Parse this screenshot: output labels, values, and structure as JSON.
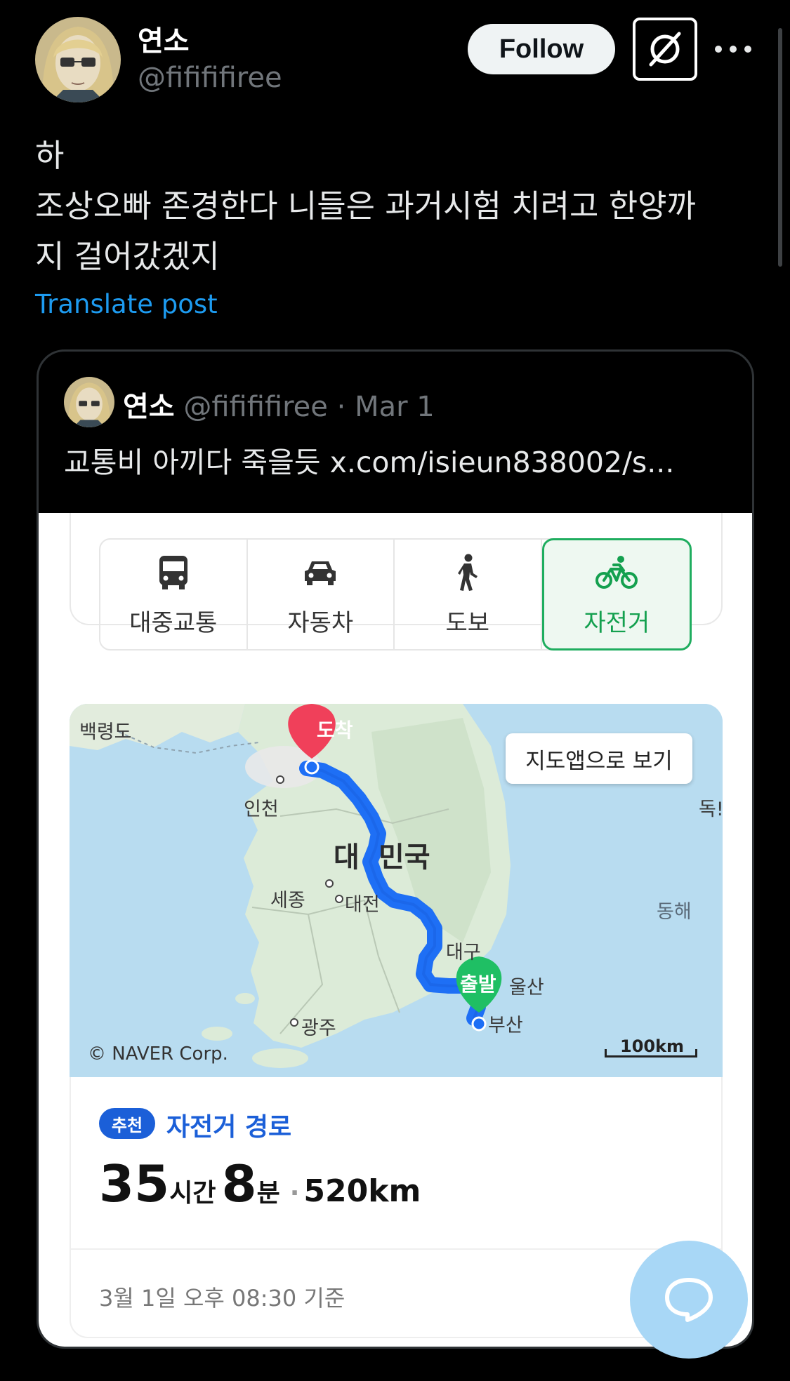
{
  "author": {
    "display_name": "연소",
    "handle": "@fifififiree",
    "avatar_icon": "anime-avatar"
  },
  "header": {
    "follow_label": "Follow",
    "grok_icon": "grok-icon",
    "more_icon": "more-dots-icon"
  },
  "post": {
    "lines": [
      "하",
      "조상오빠 존경한다 니들은 과거시험 치려고 한양까",
      "지 걸어갔겠지"
    ],
    "translate_label": "Translate post"
  },
  "quote": {
    "display_name": "연소",
    "handle": "@fifififiree",
    "separator": "·",
    "date": "Mar 1",
    "text": "교통비 아끼다 죽을듯  x.com/isieun838002/s..."
  },
  "navi": {
    "tabs": [
      {
        "label": "대중교통",
        "icon": "bus-icon",
        "active": false
      },
      {
        "label": "자동차",
        "icon": "car-icon",
        "active": false
      },
      {
        "label": "도보",
        "icon": "walk-icon",
        "active": false
      },
      {
        "label": "자전거",
        "icon": "bicycle-icon",
        "active": true
      }
    ],
    "active_color": "#1fad5f",
    "map": {
      "open_in_app_label": "지도앱으로 보기",
      "destination_marker": "도착",
      "origin_marker": "출발",
      "places": {
        "baengnyeong": "백령도",
        "incheon": "인천",
        "korea_left": "대",
        "korea_right": "민국",
        "sejong": "세종",
        "daejeon": "대전",
        "daegu": "대구",
        "ulsan": "울산",
        "busan": "부산",
        "gwangju": "광주",
        "east_sea": "동해",
        "dokdo": "독!"
      },
      "copyright": "© NAVER Corp.",
      "scale_label": "100km",
      "route_color": "#1e6ff5"
    },
    "route": {
      "badge": "추천",
      "title": "자전거 경로",
      "hours": "35",
      "hours_unit": "시간",
      "minutes": "8",
      "minutes_unit": "분",
      "separator": "·",
      "distance": "520km",
      "basis": "3월 1일 오후 08:30 기준"
    }
  },
  "fab_icon": "reply-bubble-icon"
}
